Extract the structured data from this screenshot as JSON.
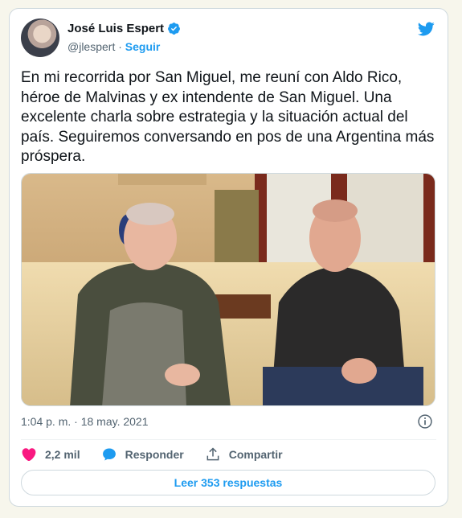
{
  "author": {
    "name": "José Luis Espert",
    "handle": "@jlespert",
    "separator": "·",
    "follow_label": "Seguir"
  },
  "tweet": {
    "text": "En mi recorrida por San Miguel, me reuní con Aldo Rico, héroe de Malvinas y ex intendente de San Miguel. Una excelente charla sobre estrategia y la situación actual del país. Seguiremos conversando en pos de una Argentina más próspera.",
    "timestamp": "1:04 p. m. · 18 may. 2021"
  },
  "actions": {
    "likes_count": "2,2 mil",
    "reply_label": "Responder",
    "share_label": "Compartir"
  },
  "replies_button": "Leer 353 respuestas",
  "colors": {
    "accent": "#1d9bf0",
    "like": "#f91880",
    "muted": "#536471",
    "background": "#f7f6ec"
  },
  "icons": [
    "verified-badge-icon",
    "twitter-bird-icon",
    "info-icon",
    "heart-icon",
    "reply-bubble-icon",
    "share-icon"
  ]
}
